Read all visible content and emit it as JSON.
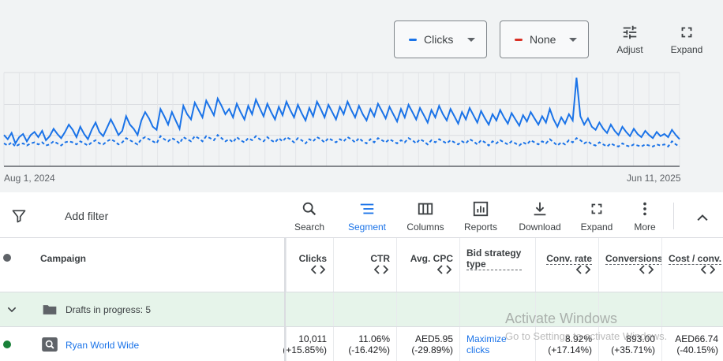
{
  "chart_controls": {
    "primary_metric": "Clicks",
    "primary_color": "#1a73e8",
    "secondary_metric": "None",
    "secondary_color": "#d93025",
    "adjust_label": "Adjust",
    "expand_label": "Expand"
  },
  "chart_data": {
    "type": "line",
    "x_start": "Aug 1, 2024",
    "x_end": "Jun 11, 2025",
    "grid": true,
    "series": [
      {
        "style": "solid",
        "color": "#1a73e8",
        "values": [
          30,
          26,
          32,
          22,
          28,
          31,
          24,
          30,
          33,
          28,
          34,
          25,
          29,
          36,
          31,
          27,
          33,
          40,
          35,
          28,
          38,
          31,
          26,
          35,
          42,
          33,
          29,
          37,
          45,
          38,
          30,
          34,
          48,
          40,
          36,
          30,
          44,
          52,
          46,
          38,
          35,
          55,
          48,
          40,
          52,
          44,
          36,
          58,
          50,
          45,
          61,
          54,
          47,
          63,
          56,
          49,
          65,
          58,
          50,
          55,
          47,
          60,
          52,
          45,
          58,
          50,
          64,
          56,
          48,
          60,
          52,
          45,
          57,
          49,
          62,
          54,
          47,
          59,
          51,
          44,
          56,
          48,
          62,
          55,
          47,
          59,
          52,
          45,
          57,
          50,
          62,
          54,
          47,
          58,
          50,
          44,
          55,
          48,
          60,
          53,
          46,
          57,
          50,
          43,
          55,
          47,
          59,
          52,
          45,
          56,
          49,
          42,
          54,
          47,
          58,
          50,
          44,
          55,
          48,
          41,
          52,
          45,
          56,
          49,
          42,
          53,
          46,
          40,
          50,
          44,
          54,
          47,
          41,
          51,
          45,
          39,
          49,
          43,
          52,
          46,
          40,
          48,
          42,
          55,
          45,
          38,
          47,
          41,
          50,
          44,
          85,
          48,
          40,
          46,
          38,
          35,
          42,
          36,
          32,
          40,
          34,
          30,
          38,
          33,
          29,
          36,
          31,
          28,
          34,
          30,
          27,
          33,
          29,
          31,
          28,
          35,
          30,
          26
        ]
      },
      {
        "style": "dashed",
        "color": "#1a73e8",
        "values": [
          22,
          20,
          23,
          19,
          21,
          22,
          20,
          22,
          23,
          21,
          23,
          20,
          21,
          24,
          22,
          20,
          23,
          24,
          23,
          21,
          24,
          22,
          20,
          23,
          25,
          22,
          21,
          24,
          26,
          24,
          21,
          23,
          27,
          25,
          23,
          21,
          26,
          28,
          26,
          24,
          22,
          29,
          26,
          24,
          27,
          25,
          22,
          28,
          26,
          24,
          29,
          27,
          24,
          29,
          27,
          25,
          30,
          27,
          24,
          26,
          23,
          28,
          25,
          23,
          27,
          25,
          29,
          26,
          24,
          28,
          25,
          23,
          27,
          24,
          28,
          26,
          23,
          27,
          25,
          22,
          26,
          24,
          28,
          26,
          23,
          27,
          25,
          23,
          26,
          24,
          28,
          26,
          23,
          27,
          24,
          22,
          26,
          23,
          27,
          25,
          23,
          26,
          24,
          22,
          25,
          23,
          27,
          25,
          22,
          26,
          24,
          21,
          25,
          23,
          26,
          24,
          22,
          25,
          23,
          21,
          24,
          22,
          26,
          24,
          21,
          25,
          23,
          20,
          24,
          22,
          25,
          23,
          21,
          24,
          22,
          20,
          23,
          21,
          25,
          23,
          21,
          24,
          22,
          26,
          23,
          20,
          23,
          21,
          25,
          23,
          27,
          25,
          22,
          24,
          21,
          20,
          23,
          21,
          19,
          22,
          20,
          19,
          22,
          20,
          19,
          21,
          20,
          19,
          21,
          20,
          19,
          21,
          20,
          21,
          19,
          24,
          21,
          19
        ]
      }
    ]
  },
  "toolbar": {
    "add_filter": "Add filter",
    "search": "Search",
    "segment": "Segment",
    "columns": "Columns",
    "reports": "Reports",
    "download": "Download",
    "expand": "Expand",
    "more": "More"
  },
  "table": {
    "headers": {
      "campaign": "Campaign",
      "clicks": "Clicks",
      "ctr": "CTR",
      "avg_cpc": "Avg. CPC",
      "bid_strategy_type": "Bid strategy type",
      "conv_rate": "Conv. rate",
      "conversions": "Conversions",
      "cost_conv": "Cost / conv."
    },
    "drafts_label": "Drafts in progress: 5",
    "rows": [
      {
        "status_color": "#188038",
        "campaign": "Ryan World Wide",
        "clicks": "10,011",
        "clicks_change": "(+15.85%)",
        "ctr": "11.06%",
        "ctr_change": "(-16.42%)",
        "avg_cpc": "AED5.95",
        "avg_cpc_change": "(-29.89%)",
        "bid_strategy_line1": "Maximize",
        "bid_strategy_line2": "clicks",
        "conv_rate": "8.92%",
        "conv_rate_change": "(+17.14%)",
        "conversions": "893.00",
        "conversions_change": "(+35.71%)",
        "cost_conv": "AED66.74",
        "cost_conv_change": "(-40.15%)"
      }
    ]
  },
  "watermark": {
    "title": "Activate Windows",
    "subtitle": "Go to Settings to activate Windows."
  }
}
